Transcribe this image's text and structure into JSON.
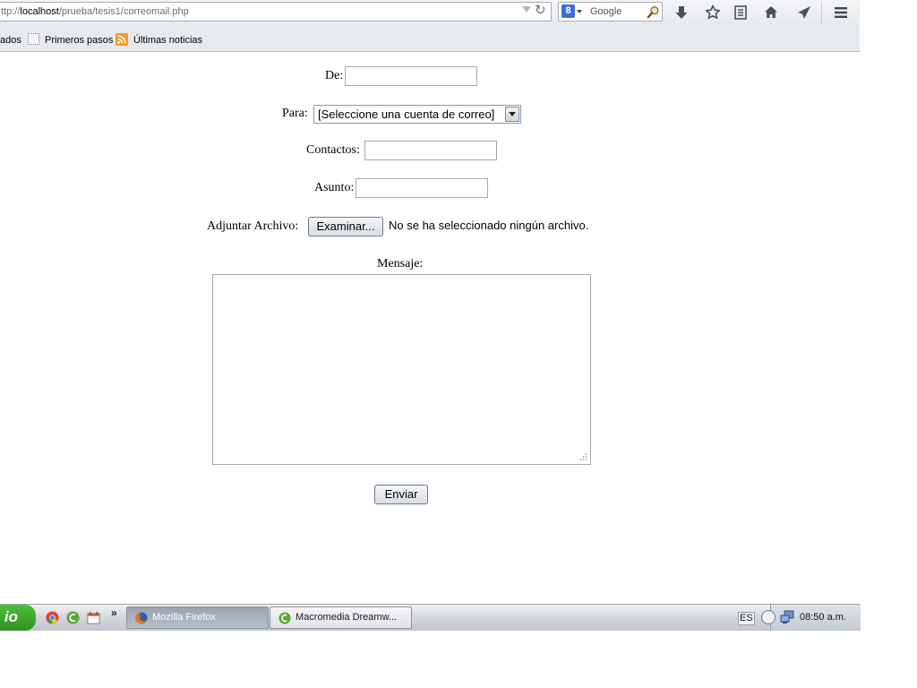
{
  "browser": {
    "url_prefix": "ttp://",
    "url_host": "localhost",
    "url_path": "/prueba/tesis1/correomail.php",
    "search_placeholder": "Google",
    "search_engine_letter": "8"
  },
  "bookmarks": {
    "items": [
      {
        "label": "ados"
      },
      {
        "label": "Primeros pasos"
      },
      {
        "label": "Últimas noticias"
      }
    ]
  },
  "form": {
    "de_label": "De:",
    "para_label": "Para:",
    "para_selected": "[Seleccione una cuenta de correo]",
    "contactos_label": "Contactos:",
    "asunto_label": "Asunto:",
    "adjuntar_label": "Adjuntar Archivo:",
    "examinar_label": "Examinar...",
    "file_status": "No se ha seleccionado ningún archivo.",
    "mensaje_label": "Mensaje:",
    "enviar_label": "Enviar",
    "de_value": "",
    "contactos_value": "",
    "asunto_value": "",
    "mensaje_value": ""
  },
  "taskbar": {
    "start_label": "io",
    "more_label": "»",
    "tasks": [
      {
        "label": "Mozilla Firefox"
      },
      {
        "label": "Macromedia Dreamw..."
      }
    ],
    "language": "ES",
    "clock": "08:50 a.m."
  },
  "colors": {
    "start_green": "#3aa52a",
    "active_task": "#a9b1bc",
    "rss_orange": "#f39a1d",
    "google_blue": "#3b6fd4"
  }
}
